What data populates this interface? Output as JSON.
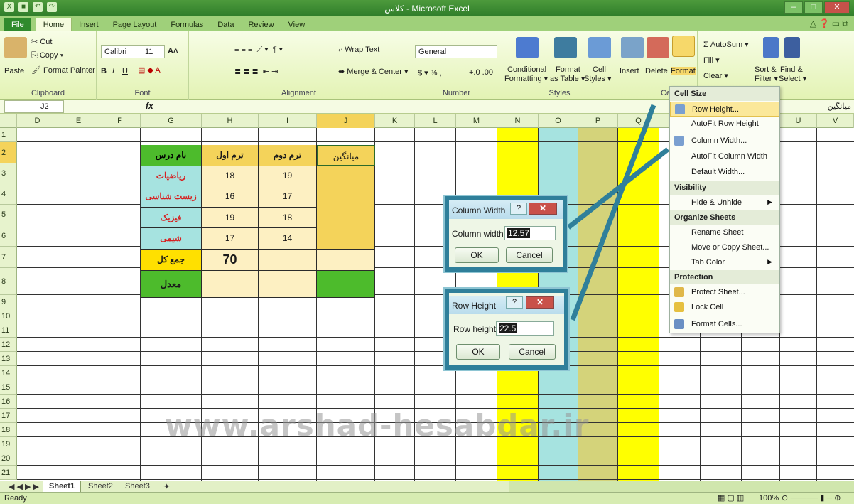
{
  "window": {
    "title": "کلاس - Microsoft Excel",
    "controls": [
      "–",
      "□",
      "✕"
    ]
  },
  "tabs": [
    "File",
    "Home",
    "Insert",
    "Page Layout",
    "Formulas",
    "Data",
    "Review",
    "View"
  ],
  "ribbon": {
    "clipboard": {
      "paste": "Paste",
      "cut": "Cut",
      "copy": "Copy ▾",
      "format_painter": "Format Painter",
      "label": "Clipboard"
    },
    "font": {
      "name": "Calibri",
      "size": "11",
      "bold": "B",
      "italic": "I",
      "underline": "U",
      "grow": "A˄",
      "shrink": "A˅",
      "label": "Font"
    },
    "alignment": {
      "wrap": "Wrap Text",
      "merge": "Merge & Center ▾",
      "label": "Alignment"
    },
    "number": {
      "format": "General",
      "currency": "$ ▾ %  ,",
      "dec": "+.0 .00",
      "label": "Number"
    },
    "styles": {
      "conditional": "Conditional",
      "conditional2": "Formatting ▾",
      "format_table": "Format",
      "format_table2": "as Table ▾",
      "cell_styles": "Cell",
      "cell_styles2": "Styles ▾",
      "label": "Styles"
    },
    "cells": {
      "insert": "Insert",
      "delete": "Delete",
      "format": "Format",
      "label": "Cells"
    },
    "editing": {
      "autosum": "Σ AutoSum ▾",
      "fill": "Fill ▾",
      "clear": "Clear ▾",
      "sort": "Sort &",
      "sort2": "Filter ▾",
      "find": "Find &",
      "find2": "Select ▾"
    }
  },
  "formula_bar": {
    "name_box": "J2",
    "fx": "fx",
    "content": "میانگین"
  },
  "columns": [
    "D",
    "E",
    "F",
    "G",
    "H",
    "I",
    "J",
    "K",
    "L",
    "M",
    "N",
    "O",
    "P",
    "Q",
    "U",
    "V"
  ],
  "rows": [
    "1",
    "2",
    "3",
    "4",
    "5",
    "6",
    "7",
    "8",
    "9",
    "10",
    "11",
    "12",
    "13",
    "14",
    "15",
    "16",
    "17",
    "18",
    "19",
    "20",
    "21"
  ],
  "table": {
    "headers": [
      "نام درس",
      "ترم اول",
      "ترم دوم",
      "میانگین"
    ],
    "subjects": [
      "ریاضیات",
      "زیست شناسی",
      "فیزیک",
      "شیمی"
    ],
    "term1": [
      "18",
      "16",
      "19",
      "17"
    ],
    "term2": [
      "19",
      "17",
      "18",
      "14"
    ],
    "total_label": "جمع کل",
    "total_value": "70",
    "avg_label": "معدل"
  },
  "dialog_column": {
    "title": "Column Width",
    "help": "?",
    "close": "✕",
    "label": "Column width:",
    "value": "12.57",
    "ok": "OK",
    "cancel": "Cancel"
  },
  "dialog_row": {
    "title": "Row Height",
    "help": "?",
    "close": "✕",
    "label": "Row height:",
    "value": "22.5",
    "ok": "OK",
    "cancel": "Cancel"
  },
  "format_menu": {
    "cell_size": "Cell Size",
    "row_height": "Row Height...",
    "autofit_row": "AutoFit Row Height",
    "column_width": "Column Width...",
    "autofit_column": "AutoFit Column Width",
    "default_width": "Default Width...",
    "visibility": "Visibility",
    "hide_unhide": "Hide & Unhide",
    "organize": "Organize Sheets",
    "rename": "Rename Sheet",
    "move_copy": "Move or Copy Sheet...",
    "tab_color": "Tab Color",
    "protection": "Protection",
    "protect": "Protect Sheet...",
    "lock": "Lock Cell",
    "format_cells": "Format Cells..."
  },
  "sheets": [
    "Sheet1",
    "Sheet2",
    "Sheet3"
  ],
  "status": {
    "ready": "Ready",
    "zoom": "100%"
  },
  "watermark": "www.arshad-hesabdar.ir",
  "colors": {
    "green_header": "#4dbb2c",
    "yellow": "#ffff00",
    "cyan": "#a6e3e0",
    "olive": "#d4d37a",
    "pink_cells": "#f3c5d8",
    "accent": "#2f7f9a"
  }
}
